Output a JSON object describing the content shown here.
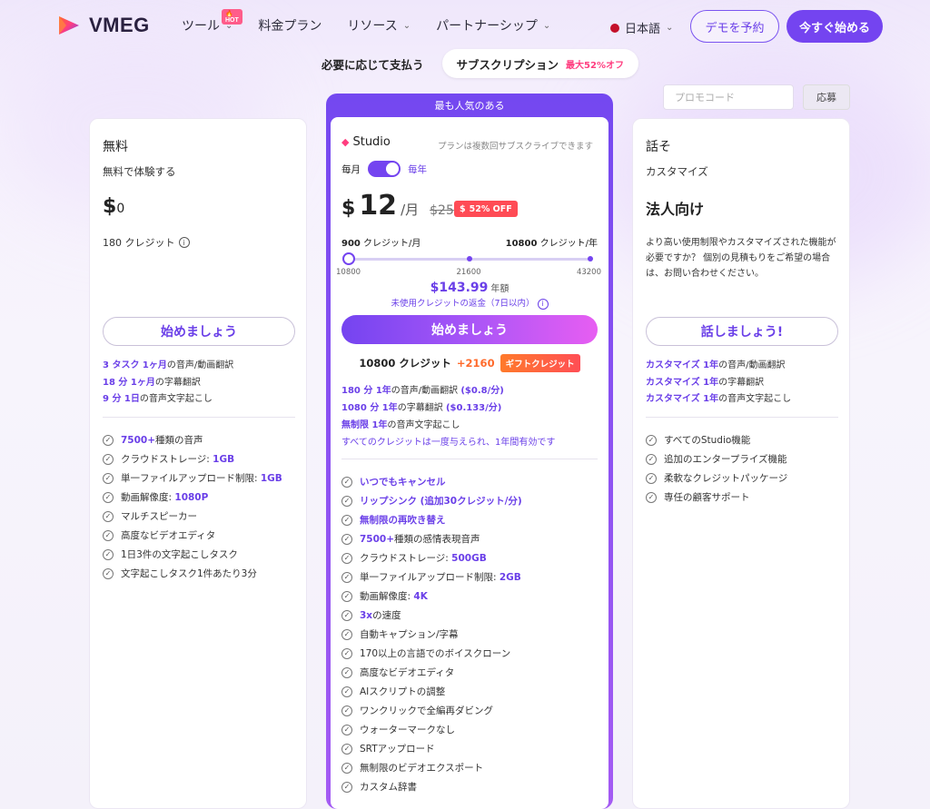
{
  "nav": {
    "logo": "VMEG",
    "menu": [
      "ツール",
      "料金プラン",
      "リソース",
      "パートナーシップ"
    ],
    "hot_badge": "🔥HOT",
    "language": "日本語",
    "demo_button": "デモを予約",
    "start_button": "今すぐ始める"
  },
  "billing": {
    "pay_as_you_go": "必要に応じて支払う",
    "subscription": "サブスクリプション",
    "discount": "最大52%オフ"
  },
  "promo": {
    "placeholder": "プロモコード",
    "apply": "応募"
  },
  "free": {
    "title": "無料",
    "subtitle": "無料で体験する",
    "price": "0",
    "currency": "$",
    "credits": "180 クレジット",
    "button": "始めましょう",
    "usage": [
      {
        "hl": "3 タスク 1ヶ月",
        "text": "の音声/動画翻訳"
      },
      {
        "hl": "18 分 1ヶ月",
        "text": "の字幕翻訳"
      },
      {
        "hl": "9 分 1日",
        "text": "の音声文字起こし"
      }
    ],
    "features": [
      {
        "hl": "7500+",
        "text": "種類の音声"
      },
      {
        "text": "クラウドストレージ: ",
        "tail": "1GB"
      },
      {
        "text": "単一ファイルアップロード制限: ",
        "tail": "1GB"
      },
      {
        "text": "動画解像度: ",
        "tail": "1080P"
      },
      {
        "text": "マルチスピーカー"
      },
      {
        "text": "高度なビデオエディタ"
      },
      {
        "text": "1日3件の文字起こしタスク"
      },
      {
        "text": "文字起こしタスク1件あたり3分"
      }
    ]
  },
  "studio": {
    "popular": "最も人気のある",
    "name": "Studio",
    "note": "プランは複数回サブスクライブできます",
    "monthly": "毎月",
    "yearly": "毎年",
    "currency": "$",
    "price": "12",
    "per": "/月",
    "old_price": "$25",
    "off_badge": "52% OFF",
    "credit_month": "900",
    "credit_month_unit": " クレジット/月",
    "credit_year": "10800",
    "credit_year_unit": " クレジット/年",
    "ticks": [
      "10800",
      "21600",
      "43200"
    ],
    "slider_level": 0,
    "year_price": "$143.99",
    "year_unit": "年額",
    "refund": "未使用クレジットの返金（7日以内）",
    "button": "始めましょう",
    "credits": "10800 クレジット",
    "bonus": "+2160",
    "gift": "ギフトクレジット",
    "usage": [
      {
        "hl": "180 分 1年",
        "text": "の音声/動画翻訳 ",
        "tail": "($0.8/分)"
      },
      {
        "hl": "1080 分 1年",
        "text": "の字幕翻訳 ",
        "tail": "($0.133/分)"
      },
      {
        "hl": "無制限 1年",
        "text": "の音声文字起こし"
      }
    ],
    "all_credits": "すべてのクレジットは一度与えられ、1年間有効です",
    "features": [
      {
        "text": "いつでもキャンセル",
        "all": true
      },
      {
        "text": "リップシンク (追加30クレジット/分)",
        "all": true
      },
      {
        "text": "無制限の再吹き替え",
        "all": true
      },
      {
        "hl": "7500+",
        "text": "種類の感情表現音声"
      },
      {
        "text": "クラウドストレージ: ",
        "tail": "500GB"
      },
      {
        "text": "単一ファイルアップロード制限: ",
        "tail": "2GB"
      },
      {
        "text": "動画解像度: ",
        "tail": "4K"
      },
      {
        "hl": "3x",
        "text": "の速度"
      },
      {
        "text": "自動キャプション/字幕"
      },
      {
        "text": "170以上の言語でのボイスクローン"
      },
      {
        "text": "高度なビデオエディタ"
      },
      {
        "text": "AIスクリプトの調整"
      },
      {
        "text": "ワンクリックで全編再ダビング"
      },
      {
        "text": "ウォーターマークなし"
      },
      {
        "text": "SRTアップロード"
      },
      {
        "text": "無制限のビデオエクスポート"
      },
      {
        "text": "カスタム辞書"
      }
    ]
  },
  "enterprise": {
    "title": "話そ",
    "subtitle": "カスタマイズ",
    "headline": "法人向け",
    "description": "より高い使用制限やカスタマイズされた機能が必要ですか？ 個別の見積もりをご希望の場合は、お問い合わせください。",
    "button": "話しましょう!",
    "usage": [
      {
        "hl": "カスタマイズ 1年",
        "text": "の音声/動画翻訳"
      },
      {
        "hl": "カスタマイズ 1年",
        "text": "の字幕翻訳"
      },
      {
        "hl": "カスタマイズ 1年",
        "text": "の音声文字起こし"
      }
    ],
    "features": [
      {
        "text": "すべてのStudio機能"
      },
      {
        "text": "追加のエンタープライズ機能"
      },
      {
        "text": "柔軟なクレジットパッケージ"
      },
      {
        "text": "専任の顧客サポート"
      }
    ]
  },
  "colors": {
    "accent": "#7444f0",
    "highlight": "#6a3fe8",
    "hot": "#ff3d7f",
    "gift": "#ff6a2b"
  }
}
